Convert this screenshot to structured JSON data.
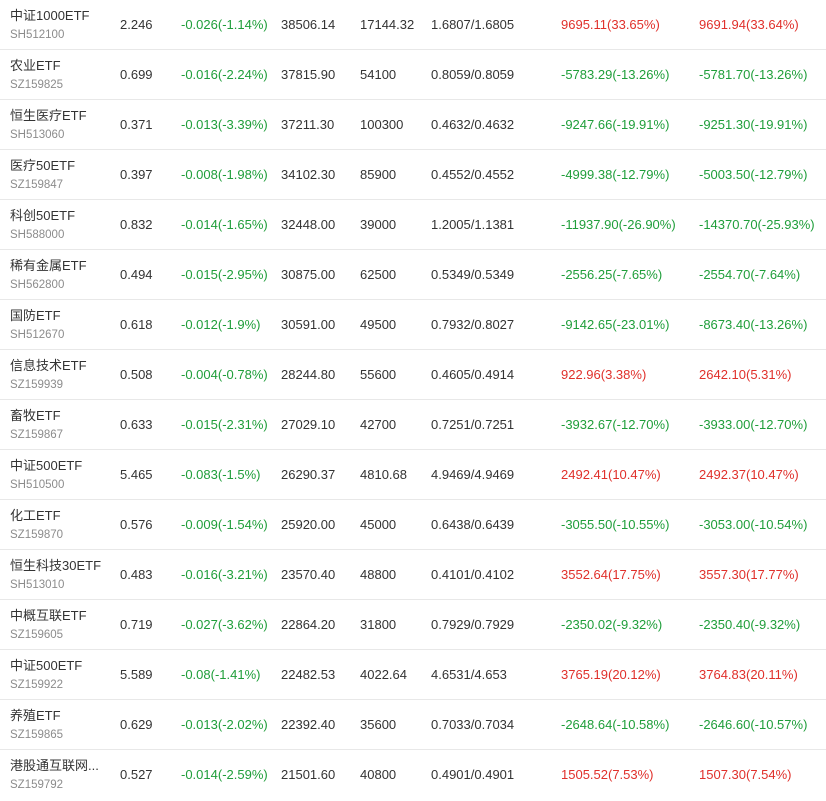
{
  "rows": [
    {
      "name": "中证1000ETF",
      "code": "SH512100",
      "price": "2.246",
      "change": "-0.026(-1.14%)",
      "amount": "38506.14",
      "volume": "17144.32",
      "cost": "1.6807/1.6805",
      "pl1": "9695.11(33.65%)",
      "pl2": "9691.94(33.64%)"
    },
    {
      "name": "农业ETF",
      "code": "SZ159825",
      "price": "0.699",
      "change": "-0.016(-2.24%)",
      "amount": "37815.90",
      "volume": "54100",
      "cost": "0.8059/0.8059",
      "pl1": "-5783.29(-13.26%)",
      "pl2": "-5781.70(-13.26%)"
    },
    {
      "name": "恒生医疗ETF",
      "code": "SH513060",
      "price": "0.371",
      "change": "-0.013(-3.39%)",
      "amount": "37211.30",
      "volume": "100300",
      "cost": "0.4632/0.4632",
      "pl1": "-9247.66(-19.91%)",
      "pl2": "-9251.30(-19.91%)"
    },
    {
      "name": "医疗50ETF",
      "code": "SZ159847",
      "price": "0.397",
      "change": "-0.008(-1.98%)",
      "amount": "34102.30",
      "volume": "85900",
      "cost": "0.4552/0.4552",
      "pl1": "-4999.38(-12.79%)",
      "pl2": "-5003.50(-12.79%)"
    },
    {
      "name": "科创50ETF",
      "code": "SH588000",
      "price": "0.832",
      "change": "-0.014(-1.65%)",
      "amount": "32448.00",
      "volume": "39000",
      "cost": "1.2005/1.1381",
      "pl1": "-11937.90(-26.90%)",
      "pl2": "-14370.70(-25.93%)"
    },
    {
      "name": "稀有金属ETF",
      "code": "SH562800",
      "price": "0.494",
      "change": "-0.015(-2.95%)",
      "amount": "30875.00",
      "volume": "62500",
      "cost": "0.5349/0.5349",
      "pl1": "-2556.25(-7.65%)",
      "pl2": "-2554.70(-7.64%)"
    },
    {
      "name": "国防ETF",
      "code": "SH512670",
      "price": "0.618",
      "change": "-0.012(-1.9%)",
      "amount": "30591.00",
      "volume": "49500",
      "cost": "0.7932/0.8027",
      "pl1": "-9142.65(-23.01%)",
      "pl2": "-8673.40(-13.26%)"
    },
    {
      "name": "信息技术ETF",
      "code": "SZ159939",
      "price": "0.508",
      "change": "-0.004(-0.78%)",
      "amount": "28244.80",
      "volume": "55600",
      "cost": "0.4605/0.4914",
      "pl1": "922.96(3.38%)",
      "pl2": "2642.10(5.31%)"
    },
    {
      "name": "畜牧ETF",
      "code": "SZ159867",
      "price": "0.633",
      "change": "-0.015(-2.31%)",
      "amount": "27029.10",
      "volume": "42700",
      "cost": "0.7251/0.7251",
      "pl1": "-3932.67(-12.70%)",
      "pl2": "-3933.00(-12.70%)"
    },
    {
      "name": "中证500ETF",
      "code": "SH510500",
      "price": "5.465",
      "change": "-0.083(-1.5%)",
      "amount": "26290.37",
      "volume": "4810.68",
      "cost": "4.9469/4.9469",
      "pl1": "2492.41(10.47%)",
      "pl2": "2492.37(10.47%)"
    },
    {
      "name": "化工ETF",
      "code": "SZ159870",
      "price": "0.576",
      "change": "-0.009(-1.54%)",
      "amount": "25920.00",
      "volume": "45000",
      "cost": "0.6438/0.6439",
      "pl1": "-3055.50(-10.55%)",
      "pl2": "-3053.00(-10.54%)"
    },
    {
      "name": "恒生科技30ETF",
      "code": "SH513010",
      "price": "0.483",
      "change": "-0.016(-3.21%)",
      "amount": "23570.40",
      "volume": "48800",
      "cost": "0.4101/0.4102",
      "pl1": "3552.64(17.75%)",
      "pl2": "3557.30(17.77%)"
    },
    {
      "name": "中概互联ETF",
      "code": "SZ159605",
      "price": "0.719",
      "change": "-0.027(-3.62%)",
      "amount": "22864.20",
      "volume": "31800",
      "cost": "0.7929/0.7929",
      "pl1": "-2350.02(-9.32%)",
      "pl2": "-2350.40(-9.32%)"
    },
    {
      "name": "中证500ETF",
      "code": "SZ159922",
      "price": "5.589",
      "change": "-0.08(-1.41%)",
      "amount": "22482.53",
      "volume": "4022.64",
      "cost": "4.6531/4.653",
      "pl1": "3765.19(20.12%)",
      "pl2": "3764.83(20.11%)"
    },
    {
      "name": "养殖ETF",
      "code": "SZ159865",
      "price": "0.629",
      "change": "-0.013(-2.02%)",
      "amount": "22392.40",
      "volume": "35600",
      "cost": "0.7033/0.7034",
      "pl1": "-2648.64(-10.58%)",
      "pl2": "-2646.60(-10.57%)"
    },
    {
      "name": "港股通互联网...",
      "code": "SZ159792",
      "price": "0.527",
      "change": "-0.014(-2.59%)",
      "amount": "21501.60",
      "volume": "40800",
      "cost": "0.4901/0.4901",
      "pl1": "1505.52(7.53%)",
      "pl2": "1507.30(7.54%)"
    }
  ],
  "colors": {
    "up": "#e0302b",
    "down": "#1f9e3a",
    "text": "#333333",
    "muted": "#8c8c8c",
    "border": "#e8e8e8"
  }
}
